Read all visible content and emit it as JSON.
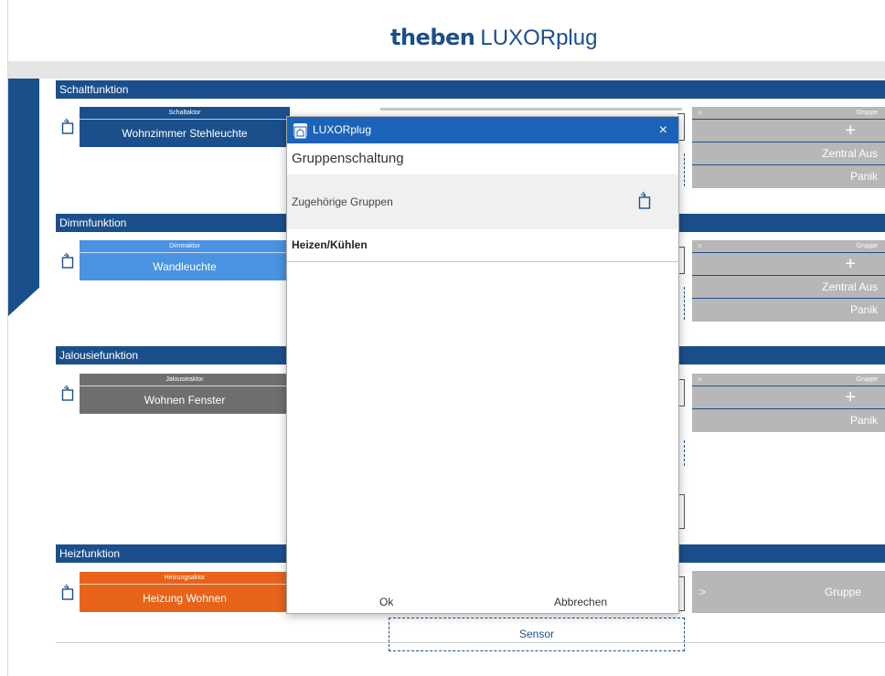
{
  "header": {
    "brand": "theben",
    "product": "LUXORplug"
  },
  "sections": [
    {
      "title": "Schaltfunktion",
      "actor_type": "Schaltaktor",
      "actor_name": "Wohnzimmer Stehleuchte",
      "groups_header": "Gruppe",
      "group_items": [
        "+",
        "Zentral Aus",
        "Panik"
      ]
    },
    {
      "title": "Dimmfunktion",
      "actor_type": "Dimmaktor",
      "actor_name": "Wandleuchte",
      "groups_header": "Gruppe",
      "group_items": [
        "+",
        "Zentral Aus",
        "Panik"
      ]
    },
    {
      "title": "Jalousiefunktion",
      "actor_type": "Jalousieaktor",
      "actor_name": "Wohnen Fenster",
      "groups_header": "Gruppe",
      "group_items": [
        "+",
        "Panik"
      ]
    },
    {
      "title": "Heizfunktion",
      "actor_type": "Heizungsaktor",
      "actor_name": "Heizung Wohnen",
      "groups_header": "Gruppe"
    }
  ],
  "arrow": ">",
  "sensor_label": "Sensor",
  "colors": {
    "primary": "#1b4f8c",
    "dimm": "#4a92e2",
    "jalousie": "#6f6f6f",
    "heiz": "#e8631a",
    "group_panel": "#b7b7b7"
  },
  "modal": {
    "window_title": "LUXORplug",
    "close_icon": "×",
    "heading": "Gruppenschaltung",
    "subheading": "Zugehörige Gruppen",
    "items": [
      "Heizen/Kühlen"
    ],
    "ok_label": "Ok",
    "cancel_label": "Abbrechen"
  }
}
